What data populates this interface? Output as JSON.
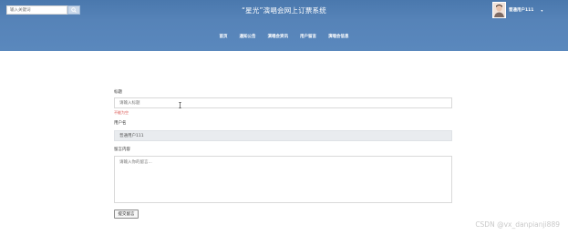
{
  "header": {
    "search_placeholder": "输入关键词",
    "site_title": "“星光”演唱会网上订票系统",
    "user_name": "普通用户111",
    "user_caret": "▾",
    "brand_color": "#5683b8"
  },
  "nav": {
    "items": [
      "首页",
      "通知公告",
      "演唱会资讯",
      "用户留言",
      "演唱会信息"
    ]
  },
  "form": {
    "title_label": "标题",
    "title_placeholder": "请输入标题",
    "title_hint": "不能为空",
    "user_label": "用户名",
    "user_value": "普通用户111",
    "content_label": "留言内容",
    "content_placeholder": "请输入你的留言...",
    "submit_label": "提交留言"
  },
  "watermark": "CSDN @vx_danpianji889",
  "icons": {
    "search": "search-icon",
    "avatar": "avatar",
    "cursor": "text-cursor-icon"
  }
}
